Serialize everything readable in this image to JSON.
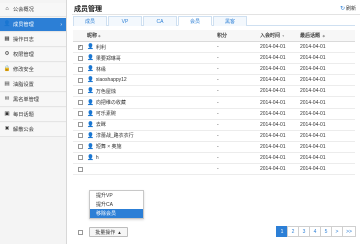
{
  "sidebar": {
    "items": [
      {
        "icon": "home-icon",
        "glyph": "⌂",
        "label": "公会概况",
        "arrow": ""
      },
      {
        "icon": "user-icon",
        "glyph": "👤",
        "label": "成员管理",
        "arrow": "›"
      },
      {
        "icon": "calendar-icon",
        "glyph": "▦",
        "label": "操作日志",
        "arrow": ""
      },
      {
        "icon": "settings-icon",
        "glyph": "⚙",
        "label": "权限管理",
        "arrow": ""
      },
      {
        "icon": "lock-icon",
        "glyph": "🔒",
        "label": "修改安全",
        "arrow": ""
      },
      {
        "icon": "chart-icon",
        "glyph": "▤",
        "label": "油脂设置",
        "arrow": ""
      },
      {
        "icon": "mail-icon",
        "glyph": "✉",
        "label": "黑名单管理",
        "arrow": ""
      },
      {
        "icon": "bell-icon",
        "glyph": "▣",
        "label": "每日话题",
        "arrow": ""
      },
      {
        "icon": "exit-icon",
        "glyph": "✖",
        "label": "解散公会",
        "arrow": ""
      }
    ]
  },
  "header": {
    "title": "成员管理",
    "refresh_label": "刷新"
  },
  "tabs": [
    {
      "label": "成员",
      "active": false
    },
    {
      "label": "VP",
      "active": false
    },
    {
      "label": "CA",
      "active": false
    },
    {
      "label": "会员",
      "active": true
    },
    {
      "label": "黑客",
      "active": false
    }
  ],
  "table": {
    "headers": {
      "name": "昵称",
      "points": "积分",
      "joined": "入会时间",
      "last": "最后话题"
    },
    "rows": [
      {
        "checked": true,
        "name": "利利",
        "points": "-",
        "joined": "2014-04-01",
        "last": "2014-04-01"
      },
      {
        "checked": false,
        "name": "果要郑琳哥",
        "points": "-",
        "joined": "2014-04-01",
        "last": "2014-04-01"
      },
      {
        "checked": false,
        "name": "林缘",
        "points": "-",
        "joined": "2014-04-01",
        "last": "2014-04-01"
      },
      {
        "checked": false,
        "name": "xiaoshappy12",
        "points": "-",
        "joined": "2014-04-01",
        "last": "2014-04-01"
      },
      {
        "checked": false,
        "name": "万色屋烛",
        "points": "-",
        "joined": "2014-04-01",
        "last": "2014-04-01"
      },
      {
        "checked": false,
        "name": "向把维の收藏",
        "points": "-",
        "joined": "2014-04-01",
        "last": "2014-04-01"
      },
      {
        "checked": false,
        "name": "可乐素碗",
        "points": "-",
        "joined": "2014-04-01",
        "last": "2014-04-01"
      },
      {
        "checked": false,
        "name": "去眯",
        "points": "-",
        "joined": "2014-04-01",
        "last": "2014-04-01"
      },
      {
        "checked": false,
        "name": "淳蕾战_路衣衣行",
        "points": "-",
        "joined": "2014-04-01",
        "last": "2014-04-01"
      },
      {
        "checked": false,
        "name": "短舞 × 奥施",
        "points": "-",
        "joined": "2014-04-01",
        "last": "2014-04-01"
      },
      {
        "checked": false,
        "name": "h",
        "points": "-",
        "joined": "2014-04-01",
        "last": "2014-04-01"
      },
      {
        "checked": false,
        "name": "",
        "points": "-",
        "joined": "2014-04-01",
        "last": "2014-04-01"
      }
    ]
  },
  "bulk": {
    "button_label": "批量操作",
    "options": [
      "提升VP",
      "提升CA",
      "移除会员"
    ],
    "highlighted_index": 2
  },
  "pager": {
    "items": [
      "1",
      "2",
      "3",
      "4",
      "5",
      ">",
      ">>"
    ],
    "active": "1"
  },
  "colors": {
    "accent": "#2c7fd6"
  }
}
